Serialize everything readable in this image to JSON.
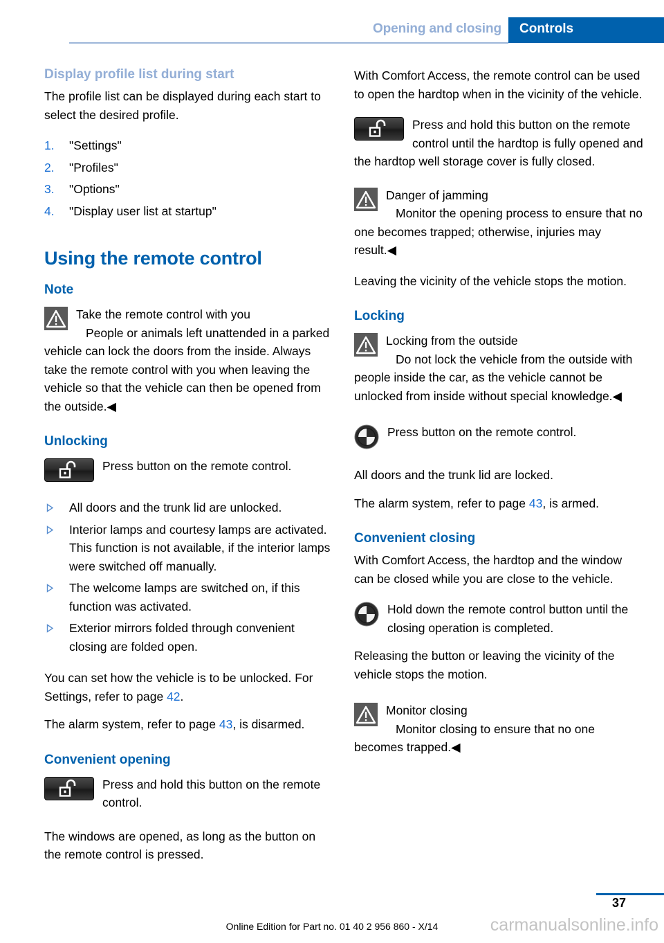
{
  "header": {
    "chapter": "Opening and closing",
    "section": "Controls",
    "accent_blue": "#0061ad",
    "muted_blue": "#93aed6"
  },
  "left_column": {
    "heading_profile": "Display profile list during start",
    "profile_intro": "The profile list can be displayed during each start to select the desired profile.",
    "profile_steps": [
      {
        "num": "1.",
        "text": "\"Settings\""
      },
      {
        "num": "2.",
        "text": "\"Profiles\""
      },
      {
        "num": "3.",
        "text": "\"Options\""
      },
      {
        "num": "4.",
        "text": "\"Display user list at startup\""
      }
    ],
    "chapter_title": "Using the remote control",
    "note_heading": "Note",
    "note_title": "Take the remote control with you",
    "note_body": "People or animals left unattended in a parked vehicle can lock the doors from the inside. Always take the remote control with you when leaving the vehicle so that the vehicle can then be opened from the outside.",
    "unlocking_heading": "Unlocking",
    "unlocking_button_text": "Press button on the remote control.",
    "unlock_results": [
      "All doors and the trunk lid are unlocked.",
      "Interior lamps and courtesy lamps are activated. This function is not available, if the interior lamps were switched off manually.",
      "The welcome lamps are switched on, if this function was activated.",
      "Exterior mirrors folded through convenient closing are folded open."
    ],
    "settings_text_before": "You can set how the vehicle is to be unlocked. For Settings, refer to page ",
    "settings_pageref": "42",
    "settings_text_after": ".",
    "alarm_text_before": "The alarm system, refer to page ",
    "alarm_pageref": "43",
    "alarm_text_after": ", is disarmed.",
    "convenient_opening_heading": "Convenient opening",
    "convenient_opening_button_text": "Press and hold this button on the remote control.",
    "convenient_opening_body": "The windows are opened, as long as the button on the remote control is pressed."
  },
  "right_column": {
    "comfort_access_intro": "With Comfort Access, the remote control can be used to open the hardtop when in the vicinity of the vehicle.",
    "hardtop_button_text": "Press and hold this button on the remote control until the hardtop is fully opened and the hardtop well storage cover is fully closed.",
    "jamming_title": "Danger of jamming",
    "jamming_body": "Monitor the opening process to ensure that no one becomes trapped; otherwise, injuries may result.",
    "leaving_vicinity": "Leaving the vicinity of the vehicle stops the motion.",
    "locking_heading": "Locking",
    "locking_warn_title": "Locking from the outside",
    "locking_warn_body": "Do not lock the vehicle from the outside with people inside the car, as the vehicle cannot be unlocked from inside without special knowledge.",
    "lock_button_text": "Press button on the remote control.",
    "locked_result": "All doors and the trunk lid are locked.",
    "alarm_text_before": "The alarm system, refer to page ",
    "alarm_pageref": "43",
    "alarm_text_after": ", is armed.",
    "convenient_closing_heading": "Convenient closing",
    "convenient_closing_intro": "With Comfort Access, the hardtop and the window can be closed while you are close to the vehicle.",
    "hold_button_text": "Hold down the remote control button until the closing operation is completed.",
    "releasing_body": "Releasing the button or leaving the vicinity of the vehicle stops the motion.",
    "monitor_title": "Monitor closing",
    "monitor_body": "Monitor closing to ensure that no one becomes trapped."
  },
  "footer": {
    "page_number": "37",
    "edition": "Online Edition for Part no. 01 40 2 956 860 - X/14",
    "watermark": "carmanualsonline.info"
  },
  "symbols": {
    "end_marker": "◀",
    "bullet_triangle": "▷"
  }
}
